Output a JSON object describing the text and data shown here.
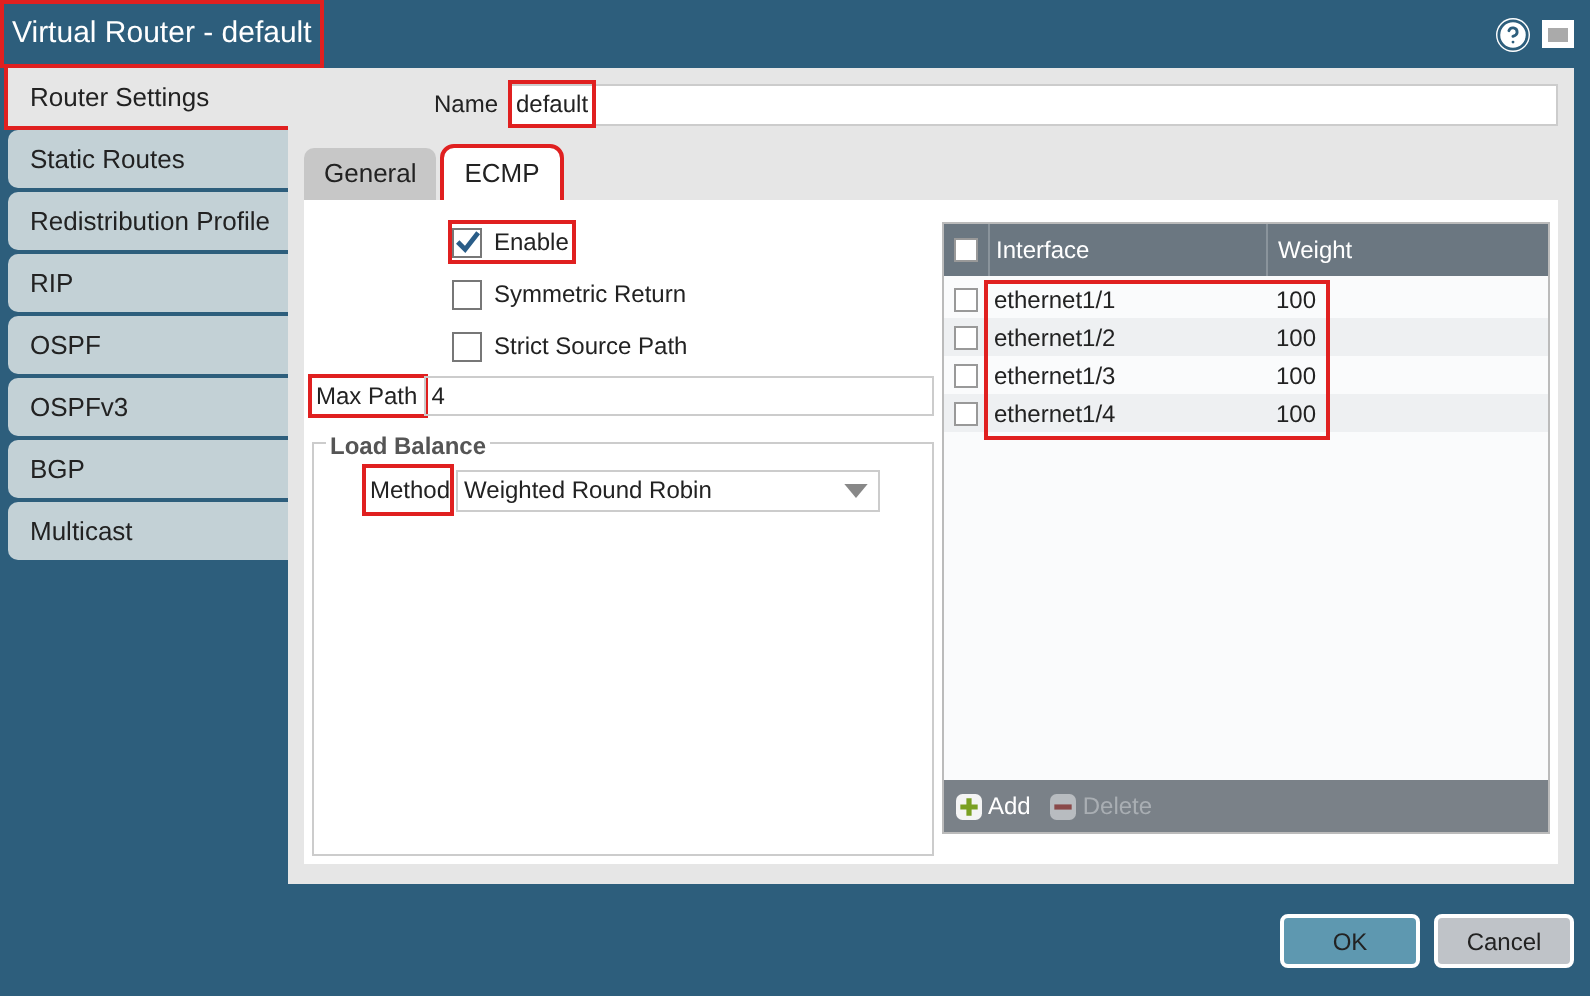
{
  "window": {
    "title": "Virtual Router - default",
    "highlighted": true
  },
  "sidebar": {
    "items": [
      {
        "label": "Router Settings",
        "selected": true,
        "highlighted": true
      },
      {
        "label": "Static Routes",
        "selected": false,
        "highlighted": false
      },
      {
        "label": "Redistribution Profile",
        "selected": false,
        "highlighted": false
      },
      {
        "label": "RIP",
        "selected": false,
        "highlighted": false
      },
      {
        "label": "OSPF",
        "selected": false,
        "highlighted": false
      },
      {
        "label": "OSPFv3",
        "selected": false,
        "highlighted": false
      },
      {
        "label": "BGP",
        "selected": false,
        "highlighted": false
      },
      {
        "label": "Multicast",
        "selected": false,
        "highlighted": false
      }
    ]
  },
  "name_field": {
    "label": "Name",
    "value": "default",
    "highlighted": true
  },
  "tabs": [
    {
      "label": "General",
      "selected": false,
      "highlighted": false
    },
    {
      "label": "ECMP",
      "selected": true,
      "highlighted": true
    }
  ],
  "options": [
    {
      "label": "Enable",
      "checked": true,
      "highlighted": true
    },
    {
      "label": "Symmetric Return",
      "checked": false,
      "highlighted": false
    },
    {
      "label": "Strict Source Path",
      "checked": false,
      "highlighted": false
    }
  ],
  "max_path": {
    "label": "Max Path",
    "value": "4",
    "highlighted": true
  },
  "load_balance": {
    "title": "Load Balance",
    "method_label": "Method",
    "method_value": "Weighted Round Robin",
    "highlighted": true
  },
  "table": {
    "columns": [
      "Interface",
      "Weight"
    ],
    "highlighted": true,
    "header_checked": false,
    "rows": [
      {
        "interface": "ethernet1/1",
        "weight": "100",
        "checked": false
      },
      {
        "interface": "ethernet1/2",
        "weight": "100",
        "checked": false
      },
      {
        "interface": "ethernet1/3",
        "weight": "100",
        "checked": false
      },
      {
        "interface": "ethernet1/4",
        "weight": "100",
        "checked": false
      }
    ],
    "actions": [
      {
        "label": "Add",
        "kind": "add",
        "disabled": false
      },
      {
        "label": "Delete",
        "kind": "delete",
        "disabled": true
      }
    ]
  },
  "buttons": [
    {
      "label": "OK",
      "kind": "primary"
    },
    {
      "label": "Cancel",
      "kind": "secondary"
    }
  ]
}
